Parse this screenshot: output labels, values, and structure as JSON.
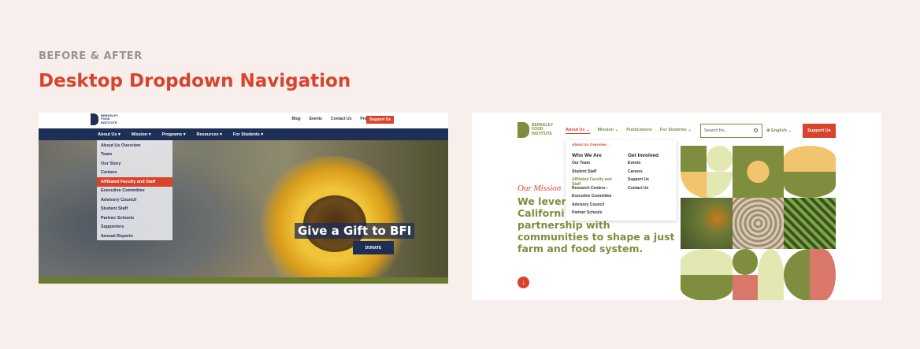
{
  "page": {
    "eyebrow": "BEFORE & AFTER",
    "title": "Desktop Dropdown Navigation"
  },
  "before": {
    "logo": [
      "BERKELEY",
      "FOOD",
      "INSTITUTE"
    ],
    "utility": [
      "Blog",
      "Events",
      "Contact Us",
      "Press"
    ],
    "support_label": "Support Us",
    "nav": [
      "About Us ▾",
      "Mission ▾",
      "Programs ▾",
      "Resources ▾",
      "For Students ▾"
    ],
    "menu": [
      "About Us Overview",
      "Team",
      "Our Story",
      "Centers",
      "Affiliated Faculty and Staff",
      "Executive Committee",
      "Advisory Council",
      "Student Staff",
      "Partner Schools",
      "Supporters",
      "Annual Reports"
    ],
    "menu_active_index": 4,
    "hero_text": "Give a Gift to BFI",
    "donate_label": "DONATE"
  },
  "after": {
    "logo": [
      "BERKELEY",
      "FOOD",
      "INSTITUTE"
    ],
    "nav": [
      "About Us ⌄",
      "Mission ⌄",
      "Publications",
      "For Students ⌄"
    ],
    "search_placeholder": "Search for...",
    "language": "⊕ English ⌄",
    "support_label": "Support Us",
    "dropdown": {
      "overview": "About Us Overview →",
      "col1_title": "Who We Are",
      "col1": [
        "Our Team",
        "Student Staff",
        "Affiliated Faculty and Staff",
        "Research Centers ›",
        "Executive Committee",
        "Advisory Council",
        "Partner Schools"
      ],
      "col2_title": "Get Involved",
      "col2": [
        "Events",
        "Careers",
        "Support Us",
        "Contact Us"
      ]
    },
    "mission_label": "Our Mission",
    "mission_text_lines": [
      "We lever",
      "Californi",
      "partnership with",
      "communities to shape a just",
      "farm and food system."
    ],
    "colors": {
      "olive": "#7f8d3f",
      "red": "#d8432b",
      "salmon": "#d9786a",
      "yellow": "#f2c46d",
      "pale": "#e3e8b3"
    }
  }
}
